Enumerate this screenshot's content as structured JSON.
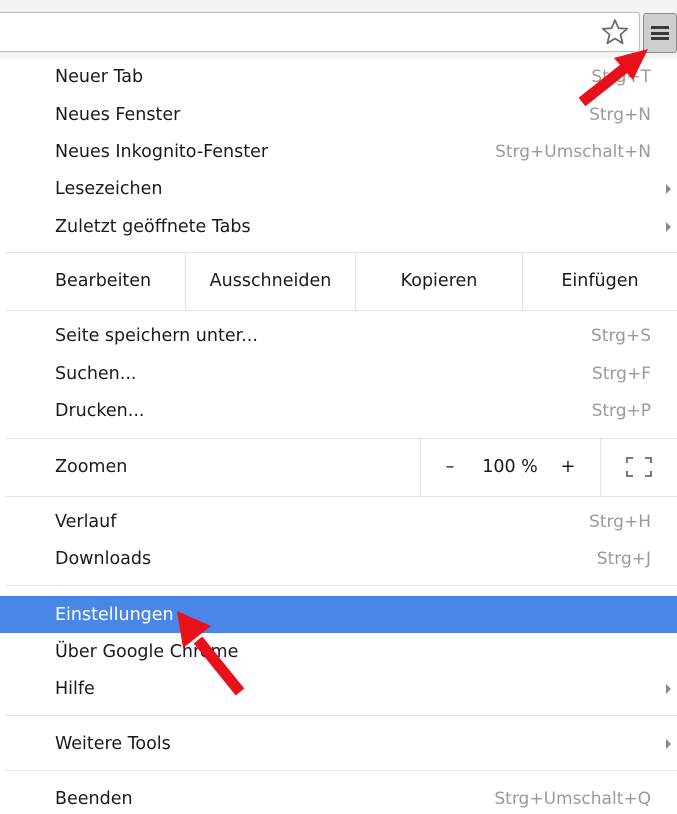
{
  "toolbar": {
    "star_icon": "star-outline-icon",
    "menu_icon": "hamburger-menu-icon"
  },
  "menu": {
    "new_tab": {
      "label": "Neuer Tab",
      "shortcut": "Strg+T"
    },
    "new_window": {
      "label": "Neues Fenster",
      "shortcut": "Strg+N"
    },
    "new_incognito": {
      "label": "Neues Inkognito-Fenster",
      "shortcut": "Strg+Umschalt+N"
    },
    "bookmarks": {
      "label": "Lesezeichen"
    },
    "recent_tabs": {
      "label": "Zuletzt geöffnete Tabs"
    },
    "edit": {
      "label": "Bearbeiten",
      "cut": "Ausschneiden",
      "copy": "Kopieren",
      "paste": "Einfügen"
    },
    "save_page": {
      "label": "Seite speichern unter...",
      "shortcut": "Strg+S"
    },
    "find": {
      "label": "Suchen...",
      "shortcut": "Strg+F"
    },
    "print": {
      "label": "Drucken...",
      "shortcut": "Strg+P"
    },
    "zoom": {
      "label": "Zoomen",
      "minus": "–",
      "value": "100 %",
      "plus": "+"
    },
    "history": {
      "label": "Verlauf",
      "shortcut": "Strg+H"
    },
    "downloads": {
      "label": "Downloads",
      "shortcut": "Strg+J"
    },
    "settings": {
      "label": "Einstellungen"
    },
    "about": {
      "label": "Über Google Chrome"
    },
    "help": {
      "label": "Hilfe"
    },
    "more_tools": {
      "label": "Weitere Tools"
    },
    "exit": {
      "label": "Beenden",
      "shortcut": "Strg+Umschalt+Q"
    }
  },
  "colors": {
    "highlight": "#4a86e8",
    "annotation_arrow": "#e8111b",
    "shortcut_text": "#9a9a9a"
  }
}
